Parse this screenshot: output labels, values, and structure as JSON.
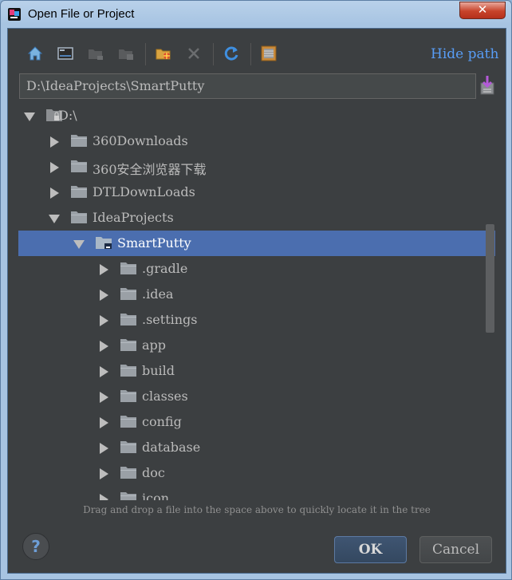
{
  "window": {
    "title": "Open File or Project",
    "close_label": "✕"
  },
  "toolbar": {
    "icons": [
      "home-icon",
      "desktop-icon",
      "project-folder-icon",
      "module-folder-icon",
      "new-folder-icon",
      "delete-icon",
      "refresh-icon",
      "show-hidden-icon"
    ],
    "hide_path_label": "Hide path"
  },
  "path": {
    "value": "D:\\IdeaProjects\\SmartPutty"
  },
  "tree": {
    "root": {
      "label": "D:\\",
      "expanded": true
    },
    "items": [
      {
        "label": "360Downloads",
        "expanded": false,
        "depth": 1
      },
      {
        "label": "360安全浏览器下载",
        "expanded": false,
        "depth": 1
      },
      {
        "label": "DTLDownLoads",
        "expanded": false,
        "depth": 1
      },
      {
        "label": "IdeaProjects",
        "expanded": true,
        "depth": 1
      },
      {
        "label": "SmartPutty",
        "expanded": true,
        "depth": 2,
        "selected": true
      },
      {
        "label": ".gradle",
        "expanded": false,
        "depth": 3
      },
      {
        "label": ".idea",
        "expanded": false,
        "depth": 3
      },
      {
        "label": ".settings",
        "expanded": false,
        "depth": 3
      },
      {
        "label": "app",
        "expanded": false,
        "depth": 3
      },
      {
        "label": "build",
        "expanded": false,
        "depth": 3
      },
      {
        "label": "classes",
        "expanded": false,
        "depth": 3
      },
      {
        "label": "config",
        "expanded": false,
        "depth": 3
      },
      {
        "label": "database",
        "expanded": false,
        "depth": 3
      },
      {
        "label": "doc",
        "expanded": false,
        "depth": 3
      },
      {
        "label": "icon",
        "expanded": false,
        "depth": 3
      }
    ]
  },
  "hint": "Drag and drop a file into the space above to quickly locate it in the tree",
  "buttons": {
    "help": "?",
    "ok": "OK",
    "cancel": "Cancel"
  },
  "colors": {
    "selection": "#4b6eaf",
    "link": "#589df6",
    "background": "#3c3f41"
  }
}
